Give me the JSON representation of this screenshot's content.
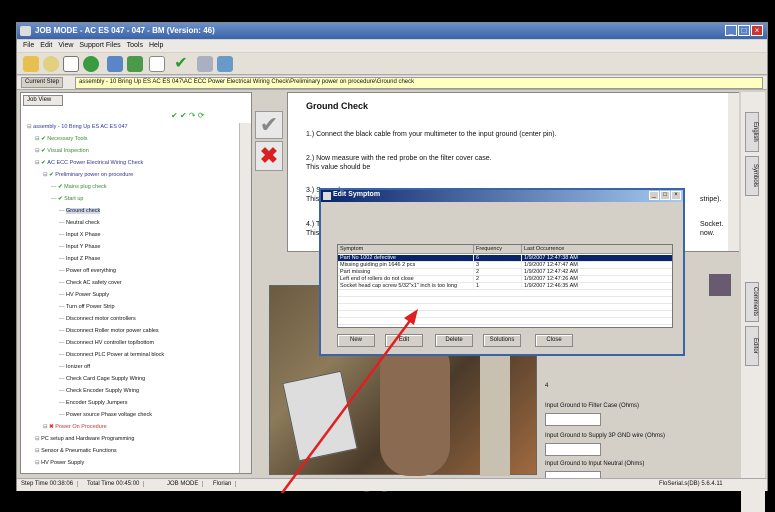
{
  "window": {
    "title": "JOB MODE - AC ES 047 - 047 - BM (Version: 46)"
  },
  "menu": [
    "File",
    "Edit",
    "View",
    "Support Files",
    "Tools",
    "Help"
  ],
  "step_bar": {
    "label": "Current Step",
    "value": "assembly - 10 Bring Up ES AC ES 047\\AC ECC Power Electrical Wiring Check\\Preliminary power on procedure\\Ground check"
  },
  "left_panel": {
    "tab": "Job View",
    "tree": [
      {
        "text": "assembly - 10 Bring Up ES AC ES 047",
        "indent": 0,
        "mark": "none",
        "style": "blue"
      },
      {
        "text": "Necessary Tools",
        "indent": 1,
        "mark": "check",
        "style": "green"
      },
      {
        "text": "Visual Inspection",
        "indent": 1,
        "mark": "check",
        "style": "green"
      },
      {
        "text": "AC ECC Power Electrical Wiring Check",
        "indent": 1,
        "mark": "check",
        "style": "blue"
      },
      {
        "text": "Preliminary power on procedure",
        "indent": 2,
        "mark": "check",
        "style": "blue"
      },
      {
        "text": "Mains plug check",
        "indent": 3,
        "mark": "check",
        "style": "green"
      },
      {
        "text": "Start up",
        "indent": 3,
        "mark": "check",
        "style": "green"
      },
      {
        "text": "Ground check",
        "indent": 4,
        "mark": "none",
        "style": "selected"
      },
      {
        "text": "Neutral check",
        "indent": 4,
        "mark": "none",
        "style": "plain"
      },
      {
        "text": "Input X Phase",
        "indent": 4,
        "mark": "none",
        "style": "plain"
      },
      {
        "text": "Input Y Phase",
        "indent": 4,
        "mark": "none",
        "style": "plain"
      },
      {
        "text": "Input Z Phase",
        "indent": 4,
        "mark": "none",
        "style": "plain"
      },
      {
        "text": "Power off everything",
        "indent": 4,
        "mark": "none",
        "style": "plain"
      },
      {
        "text": "Check AC safety cover",
        "indent": 4,
        "mark": "none",
        "style": "plain"
      },
      {
        "text": "HV Power Supply",
        "indent": 4,
        "mark": "none",
        "style": "plain"
      },
      {
        "text": "Turn off Power Strip",
        "indent": 4,
        "mark": "none",
        "style": "plain"
      },
      {
        "text": "Disconnect motor controllers",
        "indent": 4,
        "mark": "none",
        "style": "plain"
      },
      {
        "text": "Disconnect Roller motor power cables",
        "indent": 4,
        "mark": "none",
        "style": "plain"
      },
      {
        "text": "Disconnect HV controller top/bottom",
        "indent": 4,
        "mark": "none",
        "style": "plain"
      },
      {
        "text": "Disconnect PLC Power at terminal block",
        "indent": 4,
        "mark": "none",
        "style": "plain"
      },
      {
        "text": "Ionizer off",
        "indent": 4,
        "mark": "none",
        "style": "plain"
      },
      {
        "text": "Check Card Cage Supply Wiring",
        "indent": 4,
        "mark": "none",
        "style": "plain"
      },
      {
        "text": "Check Encoder Supply Wiring",
        "indent": 4,
        "mark": "none",
        "style": "plain"
      },
      {
        "text": "Encoder Supply Jumpers",
        "indent": 4,
        "mark": "none",
        "style": "plain"
      },
      {
        "text": "Power source Phase voltage check",
        "indent": 4,
        "mark": "none",
        "style": "plain"
      },
      {
        "text": "Power On Procedure",
        "indent": 2,
        "mark": "x",
        "style": "red"
      },
      {
        "text": "PC setup and Hardware Programming",
        "indent": 1,
        "mark": "none",
        "style": "plain"
      },
      {
        "text": "Sensor & Pneumatic Functions",
        "indent": 1,
        "mark": "none",
        "style": "plain"
      },
      {
        "text": "HV Power Supply",
        "indent": 1,
        "mark": "none",
        "style": "plain"
      }
    ]
  },
  "instructions": {
    "title": "Ground Check",
    "lines": [
      "1.) Connect the black cable from your multimeter to the input ground (center pin).",
      "2.) Now measure with the red probe on the filter cover case.",
      "This value should be",
      "3.) Second",
      "This value",
      "4.) Third",
      "This MEAS"
    ],
    "right_fragments": [
      "stripe).",
      "Socket.",
      "now."
    ]
  },
  "right_tabs": [
    "English",
    "Symbols",
    "Comments",
    "Editor"
  ],
  "inputs": {
    "value_top": "4",
    "fields": [
      "Input Ground to Filter Case (Ohms)",
      "Input Ground to Supply 3P GND wire (Ohms)",
      "Input Ground to Input Neutral (Ohms)"
    ]
  },
  "status": {
    "step_time": "Step Time 00:38:06",
    "total_time": "Total Time 00:45:00",
    "mode": "JOB MODE",
    "user": "Florian",
    "version": "FloSerial.s(DB) 5.6.4.11"
  },
  "dialog": {
    "title": "Edit Symptom",
    "columns": [
      "Symptom",
      "Frequency",
      "Last Occurrence"
    ],
    "rows": [
      [
        "Part No 1002 defective",
        "6",
        "1/9/2007 12:47:38 AM"
      ],
      [
        "Missing guiding pin 1646 2 pcs",
        "3",
        "1/9/2007 12:47:47 AM"
      ],
      [
        "Part missing",
        "2",
        "1/9/2007 12:47:42 AM"
      ],
      [
        "Left end of rollers do not close",
        "2",
        "1/9/2007 12:47:26 AM"
      ],
      [
        "Socket head cap screw 5/32\"x1\" inch is too long",
        "1",
        "1/9/2007 12:46:35 AM"
      ]
    ],
    "buttons": [
      "New",
      "Edit",
      "Delete",
      "Solutions",
      "Close"
    ]
  },
  "colors": {
    "title_blue": "#3a64a8",
    "step_yellow": "#ffffc0",
    "selection": "#0a246a",
    "annotation_arrow": "#e02020"
  }
}
